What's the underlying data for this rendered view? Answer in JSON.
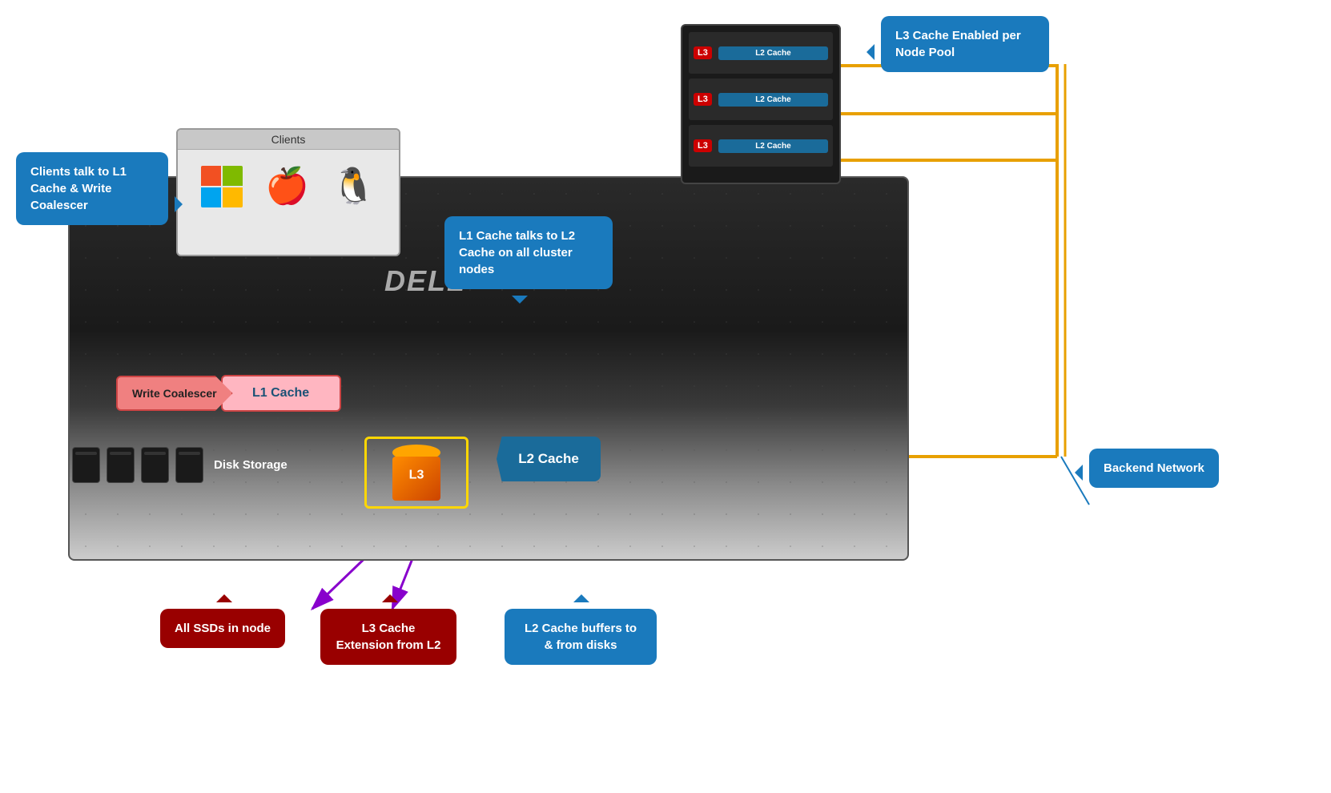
{
  "callouts": {
    "clients": {
      "text": "Clients talk to L1 Cache & Write Coalescer"
    },
    "l1_l2": {
      "text": "L1 Cache talks to L2 Cache on all cluster nodes"
    },
    "l3_node": {
      "text": "L3 Cache Enabled per Node Pool"
    },
    "backend": {
      "text": "Backend Network"
    },
    "ssds": {
      "text": "All SSDs in node"
    },
    "l3_ext": {
      "text": "L3 Cache Extension from L2"
    },
    "l2_buffers": {
      "text": "L2 Cache buffers to & from disks"
    }
  },
  "clients_window": {
    "title": "Clients"
  },
  "labels": {
    "write_coalescer": "Write Coalescer",
    "l1_cache": "L1 Cache",
    "disk_storage": "Disk Storage",
    "l3": "L3",
    "l2_cache": "L2 Cache",
    "dell": "DELL"
  },
  "node_rows": [
    {
      "l3": "L3",
      "l2": "L2 Cache"
    },
    {
      "l3": "L3",
      "l2": "L2 Cache"
    },
    {
      "l3": "L3",
      "l2": "L2 Cache"
    }
  ],
  "colors": {
    "blue_callout": "#1a7abd",
    "red_callout": "#990000",
    "yellow_border": "#ffd700",
    "purple_arrow": "#8b00c8",
    "orange_gold_line": "#e8a000"
  }
}
